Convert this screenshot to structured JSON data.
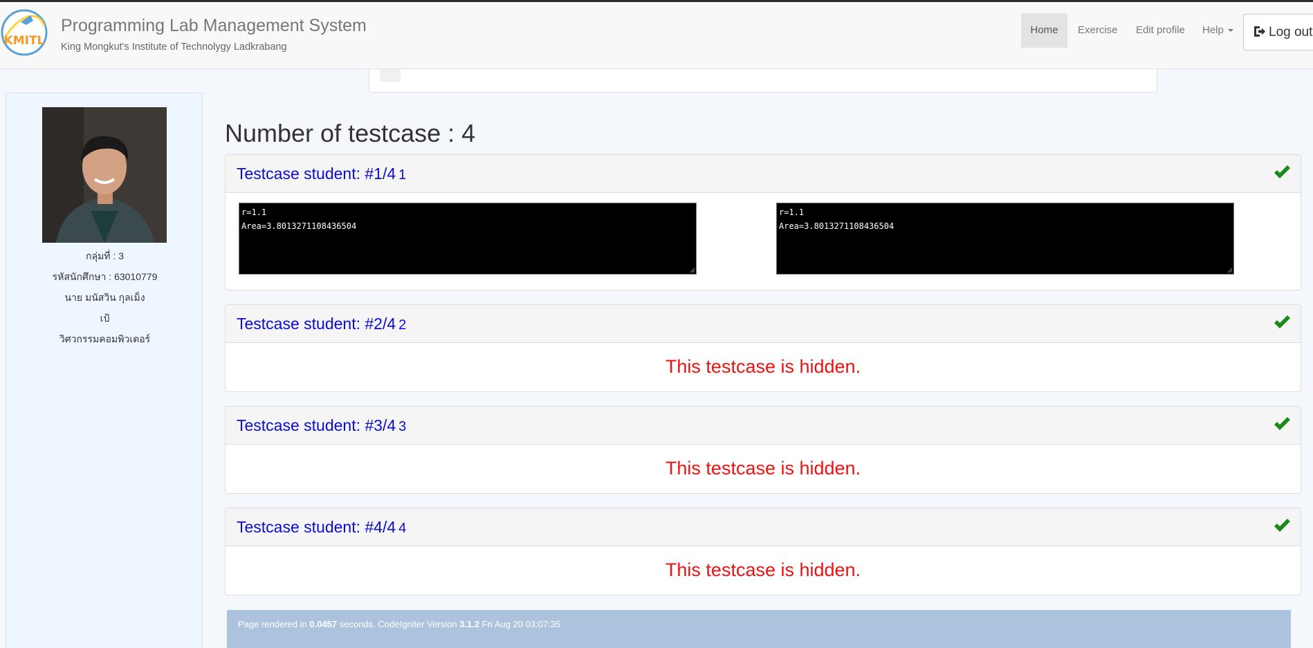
{
  "header": {
    "title": "Programming Lab Management System",
    "subtitle": "King Mongkut's Institute of Technolygy Ladkrabang",
    "logo_text": "KMITL"
  },
  "nav": {
    "home": "Home",
    "exercise": "Exercise",
    "edit_profile": "Edit profile",
    "help": "Help",
    "logout": "Log out"
  },
  "profile": {
    "group": "กลุ่มที่ : 3",
    "student_id": "รหัสนักศึกษา : 63010779",
    "name": "นาย มนัสวิน กุลเม็ง",
    "nickname": "เป้",
    "department": "วิศวกรรมคอมพิวเตอร์"
  },
  "main": {
    "title": "Number of testcase : 4",
    "testcases": [
      {
        "title": "Testcase student: #1/4",
        "num": "1",
        "passed": true,
        "student_output": [
          "r=1.1",
          "Area=3.8013271108436504"
        ],
        "expected_output": [
          "r=1.1",
          "Area=3.8013271108436504"
        ]
      },
      {
        "title": "Testcase student: #2/4",
        "num": "2",
        "passed": true,
        "hidden_text": "This testcase is hidden."
      },
      {
        "title": "Testcase student: #3/4",
        "num": "3",
        "passed": true,
        "hidden_text": "This testcase is hidden."
      },
      {
        "title": "Testcase student: #4/4",
        "num": "4",
        "passed": true,
        "hidden_text": "This testcase is hidden."
      }
    ]
  },
  "footer": {
    "prefix": "Page rendered in",
    "seconds": "0.0457",
    "middle": "seconds. CodeIgniter Version",
    "version": "3.1.2",
    "datetime": "Fri Aug 20 03:07:35"
  },
  "colors": {
    "accent_blue": "#0b0bd8",
    "hidden_red": "#ee1111",
    "check_green": "#1a8a1a",
    "footer_bg": "#adc3dd"
  }
}
